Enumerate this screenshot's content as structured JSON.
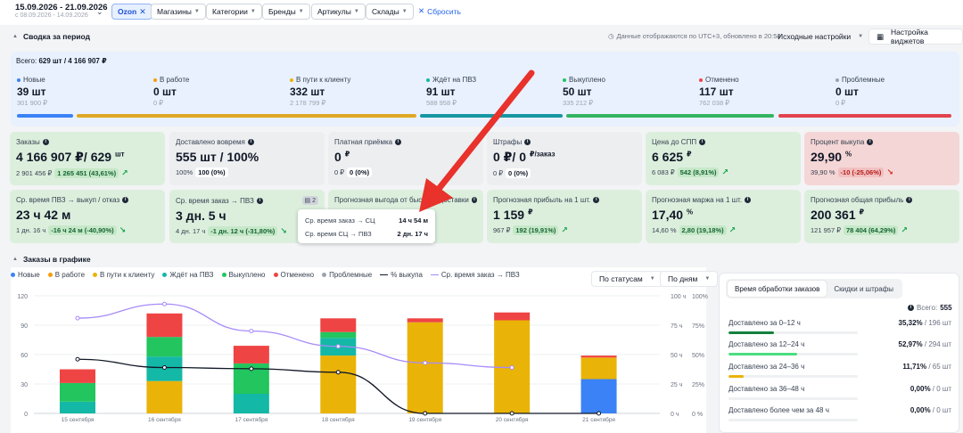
{
  "filters": {
    "date_main": "15.09.2026 - 21.09.2026",
    "date_compare": "с 08.09.2026 - 14.09.2026",
    "chips": [
      {
        "label": "Ozon",
        "active": true
      },
      {
        "label": "Магазины"
      },
      {
        "label": "Категории"
      },
      {
        "label": "Бренды"
      },
      {
        "label": "Артикулы"
      },
      {
        "label": "Склады"
      }
    ],
    "reset_label": "Сбросить"
  },
  "summary": {
    "title": "Сводка за период",
    "info_text": "Данные отображаются по UTC+3, обновлено в 20:54",
    "preset_label": "Исходные настройки",
    "widgets_label": "Настройка виджетов",
    "total_label": "Всего:",
    "total_value": "629 шт / 4 166 907 ₽",
    "statuses": [
      {
        "label": "Новые",
        "value": "39 шт",
        "sub": "301 900 ₽",
        "color": "#3b82f6"
      },
      {
        "label": "В работе",
        "value": "0 шт",
        "sub": "0 ₽",
        "color": "#f59e0b"
      },
      {
        "label": "В пути к клиенту",
        "value": "332 шт",
        "sub": "2 178 799 ₽",
        "color": "#eab308"
      },
      {
        "label": "Ждёт на ПВЗ",
        "value": "91 шт",
        "sub": "588 958 ₽",
        "color": "#14b8a6"
      },
      {
        "label": "Выкуплено",
        "value": "50 шт",
        "sub": "335 212 ₽",
        "color": "#22c55e"
      },
      {
        "label": "Отменено",
        "value": "117 шт",
        "sub": "762 038 ₽",
        "color": "#ef4444"
      },
      {
        "label": "Проблемные",
        "value": "0 шт",
        "sub": "0 ₽",
        "color": "#9ca3af"
      }
    ],
    "bar_colors": {
      "blue": "#3b82f6",
      "yellow": "#e0a823",
      "teal": "#1597a2",
      "green": "#35b463",
      "red": "#e2434e"
    }
  },
  "cards_row1": [
    {
      "title": "Заказы",
      "value": "4 166 907 ₽/ 629",
      "unit": "шт",
      "sub_prev": "2 901 456 ₽",
      "sub_delta": "1 265 451 (43,61%)",
      "trend": "up",
      "theme": "green"
    },
    {
      "title": "Доставлено вовремя",
      "value": "555 шт / 100%",
      "unit": "",
      "sub_prev": "100%",
      "sub_delta": "100 (0%)",
      "trend": "none",
      "theme": "gray"
    },
    {
      "title": "Платная приёмка",
      "value": "0",
      "unit": "₽",
      "sub_prev": "0 ₽",
      "sub_delta": "0 (0%)",
      "trend": "none",
      "theme": "gray"
    },
    {
      "title": "Штрафы",
      "value": "0 ₽/ 0",
      "unit": "₽/заказ",
      "sub_prev": "0 ₽",
      "sub_delta": "0 (0%)",
      "trend": "none",
      "theme": "gray"
    },
    {
      "title": "Цена до СПП",
      "value": "6 625",
      "unit": "₽",
      "sub_prev": "6 083 ₽",
      "sub_delta": "542 (8,91%)",
      "trend": "up",
      "theme": "green"
    },
    {
      "title": "Процент выкупа",
      "value": "29,90",
      "unit": "%",
      "sub_prev": "39,90 %",
      "sub_delta": "-10 (-25,06%)",
      "trend": "down",
      "theme": "red"
    }
  ],
  "cards_row2": [
    {
      "title": "Ср. время ПВЗ → выкуп / отказ",
      "value": "23 ч 42 м",
      "unit": "",
      "sub_prev": "1 дн. 16 ч",
      "sub_delta": "-16 ч 24 м (-40,90%)",
      "trend": "down-good",
      "theme": "green"
    },
    {
      "title": "Ср. время заказ → ПВЗ",
      "value": "3 дн. 5 ч",
      "unit": "",
      "sub_prev": "4 дн. 17 ч",
      "sub_delta": "-1 дн. 12 ч (-31,80%)",
      "trend": "down-good",
      "theme": "green",
      "badge": "2"
    },
    {
      "title": "Прогнозная выгода от быстрой доставки",
      "value": "",
      "unit": "",
      "sub_prev": "",
      "sub_delta": "",
      "trend": "none",
      "theme": "green"
    },
    {
      "title": "Прогнозная прибыль на 1 шт.",
      "value": "1 159",
      "unit": "₽",
      "sub_prev": "967 ₽",
      "sub_delta": "192 (19,91%)",
      "trend": "up",
      "theme": "green"
    },
    {
      "title": "Прогнозная маржа на 1 шт.",
      "value": "17,40",
      "unit": "%",
      "sub_prev": "14,60 %",
      "sub_delta": "2,80 (19,18%)",
      "trend": "up",
      "theme": "green"
    },
    {
      "title": "Прогнозная общая прибыль",
      "value": "200 361",
      "unit": "₽",
      "sub_prev": "121 957 ₽",
      "sub_delta": "78 404 (64,29%)",
      "trend": "up",
      "theme": "green"
    }
  ],
  "tooltip": {
    "rows": [
      {
        "label": "Ср. время заказ → СЦ",
        "value": "14 ч 54 м"
      },
      {
        "label": "Ср. время СЦ → ПВЗ",
        "value": "2 дн. 17 ч"
      }
    ]
  },
  "orders_chart": {
    "section_title": "Заказы в графике",
    "group_by_label": "По статусам",
    "period_label": "По дням",
    "legend": [
      {
        "label": "Новые",
        "color": "#3b82f6",
        "kind": "dot"
      },
      {
        "label": "В работе",
        "color": "#f59e0b",
        "kind": "dot"
      },
      {
        "label": "В пути к клиенту",
        "color": "#eab308",
        "kind": "dot"
      },
      {
        "label": "Ждёт на ПВЗ",
        "color": "#14b8a6",
        "kind": "dot"
      },
      {
        "label": "Выкуплено",
        "color": "#22c55e",
        "kind": "dot"
      },
      {
        "label": "Отменено",
        "color": "#ef4444",
        "kind": "dot"
      },
      {
        "label": "Проблемные",
        "color": "#9ca3af",
        "kind": "dot"
      },
      {
        "label": "% выкупа",
        "color": "#111827",
        "kind": "line"
      },
      {
        "label": "Ср. время заказ → ПВЗ",
        "color": "#a78bfa",
        "kind": "line"
      }
    ]
  },
  "chart_data": {
    "type": "bar",
    "stacked": true,
    "categories": [
      "15 сентября",
      "16 сентября",
      "17 сентября",
      "18 сентября",
      "19 сентября",
      "20 сентября",
      "21 сентября"
    ],
    "series": [
      {
        "name": "Новые",
        "color": "#3b82f6",
        "values": [
          0,
          0,
          0,
          0,
          0,
          0,
          35
        ]
      },
      {
        "name": "В пути к клиенту",
        "color": "#eab308",
        "values": [
          0,
          33,
          0,
          59,
          93,
          95,
          22
        ]
      },
      {
        "name": "Ждёт на ПВЗ",
        "color": "#14b8a6",
        "values": [
          12,
          25,
          20,
          18,
          0,
          0,
          0
        ]
      },
      {
        "name": "Выкуплено",
        "color": "#22c55e",
        "values": [
          19,
          20,
          31,
          6,
          0,
          0,
          0
        ]
      },
      {
        "name": "Отменено",
        "color": "#ef4444",
        "values": [
          14,
          24,
          18,
          14,
          4,
          8,
          2
        ]
      },
      {
        "name": "Проблемные",
        "color": "#9ca3af",
        "values": [
          0,
          0,
          0,
          0,
          0,
          0,
          0
        ]
      }
    ],
    "lines": [
      {
        "name": "% выкупа",
        "color": "#111827",
        "axis": "right-pct",
        "values": [
          46,
          39,
          38,
          35,
          0,
          0,
          0
        ]
      },
      {
        "name": "Ср. время заказ → ПВЗ",
        "color": "#a78bfa",
        "axis": "right-hours",
        "values": [
          81,
          93,
          70,
          57,
          43,
          39,
          null
        ]
      }
    ],
    "y_left": {
      "ticks": [
        0,
        30,
        60,
        90,
        120
      ],
      "range": [
        0,
        120
      ]
    },
    "y_right_hours": {
      "ticks": [
        "0 ч",
        "25 ч",
        "50 ч",
        "75 ч",
        "100 ч"
      ],
      "range": [
        0,
        100
      ]
    },
    "y_right_pct": {
      "ticks": [
        "0 %",
        "25%",
        "50%",
        "75%",
        "100%"
      ],
      "range": [
        0,
        100
      ]
    }
  },
  "processing": {
    "tabs": [
      {
        "label": "Время обработки заказов",
        "active": true
      },
      {
        "label": "Скидки и штрафы",
        "active": false
      }
    ],
    "total_label": "Всего:",
    "total_value": "555",
    "rows": [
      {
        "label": "Доставлено за 0–12 ч",
        "pct": "35,32%",
        "count": "/ 196 шт",
        "fraction": 0.3532,
        "color": "#15803d"
      },
      {
        "label": "Доставлено за 12–24 ч",
        "pct": "52,97%",
        "count": "/ 294 шт",
        "fraction": 0.5297,
        "color": "#4ade80"
      },
      {
        "label": "Доставлено за 24–36 ч",
        "pct": "11,71%",
        "count": "/ 65 шт",
        "fraction": 0.1171,
        "color": "#eab308"
      },
      {
        "label": "Доставлено за 36–48 ч",
        "pct": "0,00%",
        "count": "/ 0 шт",
        "fraction": 0,
        "color": "#f97316"
      },
      {
        "label": "Доставлено более чем за 48 ч",
        "pct": "0,00%",
        "count": "/ 0 шт",
        "fraction": 0,
        "color": "#ef4444"
      }
    ]
  }
}
